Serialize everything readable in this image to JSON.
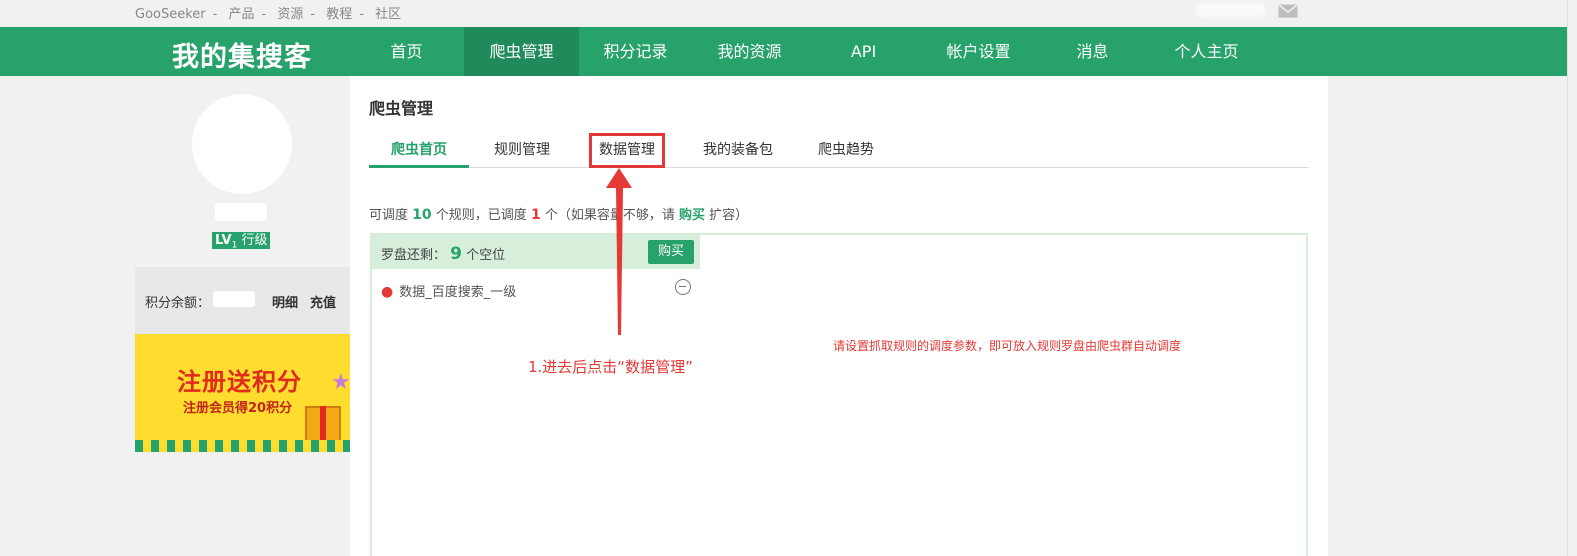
{
  "topbar": {
    "links": [
      "GooSeeker",
      "产品",
      "资源",
      "教程",
      "社区"
    ],
    "separator": "-"
  },
  "brand": "我的集搜客",
  "nav": {
    "items": [
      "首页",
      "爬虫管理",
      "积分记录",
      "我的资源",
      "API",
      "帐户设置",
      "消息",
      "个人主页"
    ],
    "active": "爬虫管理"
  },
  "sidebar": {
    "level_prefix": "LV",
    "level_sub": "1",
    "level_name": "行级",
    "points_label": "积分余额：",
    "details_link": "明细",
    "recharge_link": "充值",
    "banner": {
      "title": "注册送积分",
      "subtitle": "注册会员得20积分"
    }
  },
  "main": {
    "title": "爬虫管理",
    "tabs": [
      "爬虫首页",
      "规则管理",
      "数据管理",
      "我的装备包",
      "爬虫趋势"
    ],
    "active_tab": "爬虫首页",
    "highlighted_tab": "数据管理",
    "quota": {
      "part1": "可调度",
      "total": "10",
      "part2": "个规则，已调度",
      "used": "1",
      "part3": "个（如果容量不够，请",
      "buy_link": "购买",
      "part4": "扩容）"
    },
    "compass": {
      "slots_label": "罗盘还剩：",
      "slots_count": "9",
      "slots_unit": "个空位",
      "buy_button": "购买",
      "rules": [
        "数据_百度搜索_一级"
      ],
      "hint": "请设置抓取规则的调度参数，即可放入规则罗盘由爬虫群自动调度"
    }
  },
  "annotation": "1.进去后点击“数据管理”",
  "colors": {
    "brand_green": "#27a26b",
    "annotation_red": "#e53935"
  }
}
